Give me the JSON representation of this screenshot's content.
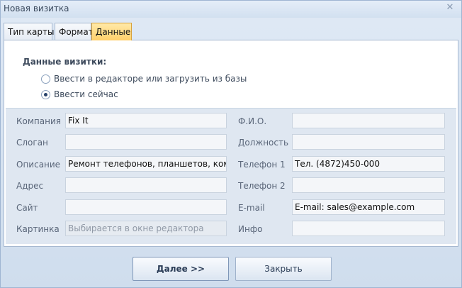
{
  "window": {
    "title": "Новая визитка",
    "close_glyph": "✕"
  },
  "tabs": [
    {
      "label": "Тип карты",
      "active": false
    },
    {
      "label": "Формат",
      "active": false
    },
    {
      "label": "Данные",
      "active": true
    }
  ],
  "data_section": {
    "label": "Данные визитки:",
    "options": [
      {
        "label": "Ввести в редакторе или загрузить из базы",
        "checked": false
      },
      {
        "label": "Ввести сейчас",
        "checked": true
      }
    ]
  },
  "fields_left": [
    {
      "label": "Компания",
      "value": "Fix It"
    },
    {
      "label": "Слоган",
      "value": ""
    },
    {
      "label": "Описание",
      "value": "Ремонт телефонов, планшетов, компью"
    },
    {
      "label": "Адрес",
      "value": ""
    },
    {
      "label": "Сайт",
      "value": ""
    },
    {
      "label": "Картинка",
      "value": "Выбирается в окне редактора",
      "disabled": true
    }
  ],
  "fields_right": [
    {
      "label": "Ф.И.О.",
      "value": ""
    },
    {
      "label": "Должность",
      "value": ""
    },
    {
      "label": "Телефон 1",
      "value": "Тел. (4872)450-000"
    },
    {
      "label": "Телефон 2",
      "value": ""
    },
    {
      "label": "E-mail",
      "value": "E-mail: sales@example.com"
    },
    {
      "label": "Инфо",
      "value": ""
    }
  ],
  "buttons": {
    "next": "Далее >>",
    "close": "Закрыть"
  },
  "colors": {
    "active_tab": "#ffcf6a",
    "panel_bg": "#dfe7f1",
    "window_bg": "#cfdded"
  }
}
